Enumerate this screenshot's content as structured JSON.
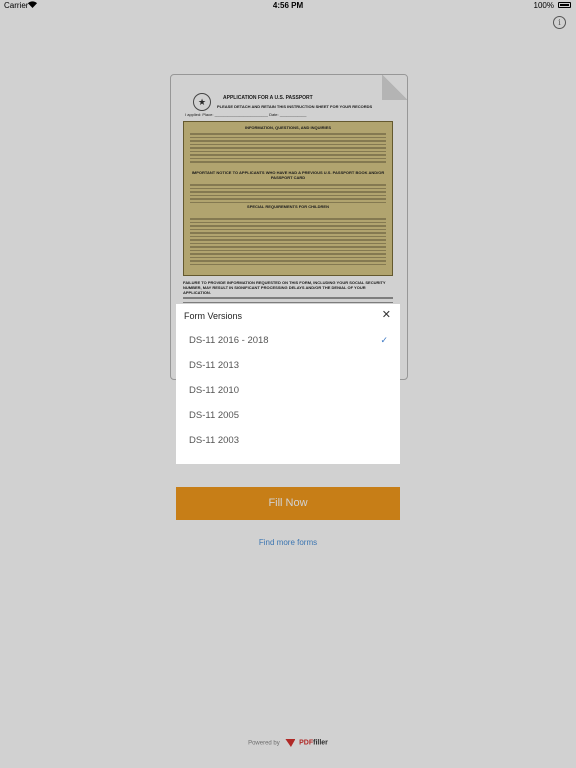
{
  "status_bar": {
    "carrier": "Carrier",
    "time": "4:56 PM",
    "battery": "100%"
  },
  "info_button": {
    "icon": "info-icon",
    "glyph": "i"
  },
  "document": {
    "title": "APPLICATION FOR A U.S. PASSPORT",
    "subtitle": "PLEASE DETACH AND RETAIN THIS INSTRUCTION SHEET FOR YOUR RECORDS",
    "applied_line": "I applied:   Place: ________________________   Date: ____________",
    "info_heading": "INFORMATION, QUESTIONS, AND INQUIRIES",
    "important_heading": "IMPORTANT NOTICE TO APPLICANTS WHO HAVE HAD A PREVIOUS U.S. PASSPORT BOOK AND/OR PASSPORT CARD",
    "special_heading": "SPECIAL REQUIREMENTS FOR CHILDREN",
    "failure_notice": "FAILURE TO PROVIDE INFORMATION REQUESTED ON THIS FORM, INCLUDING YOUR SOCIAL SECURITY NUMBER, MAY RESULT IN SIGNIFICANT PROCESSING DELAYS AND/OR THE DENIAL OF YOUR APPLICATION."
  },
  "popup": {
    "title": "Form Versions",
    "close_icon": "close-icon",
    "items": [
      {
        "label": "DS-11 2016 - 2018",
        "selected": true
      },
      {
        "label": "DS-11 2013",
        "selected": false
      },
      {
        "label": "DS-11 2010",
        "selected": false
      },
      {
        "label": "DS-11 2005",
        "selected": false
      },
      {
        "label": "DS-11 2003",
        "selected": false
      }
    ],
    "check_glyph": "✓"
  },
  "fill_button": {
    "label": "Fill Now",
    "color": "#f39a1d"
  },
  "find_more": {
    "label": "Find more forms",
    "color": "#4a90d9"
  },
  "footer": {
    "powered_by": "Powered by",
    "brand_pdf": "PDF",
    "brand_filler": "filler"
  }
}
